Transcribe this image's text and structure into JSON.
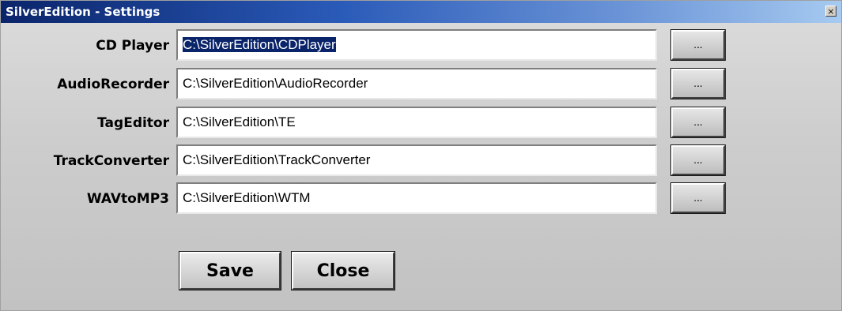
{
  "window": {
    "title": "SilverEdition - Settings",
    "close_glyph": "×",
    "close_icon": "close-icon"
  },
  "colors": {
    "titlebar_start": "#0a246a",
    "titlebar_end": "#a6caf0",
    "selection": "#0a246a",
    "background": "#cdcdcd"
  },
  "settings": {
    "rows": [
      {
        "label": "CD Player",
        "value": "C:\\SilverEdition\\CDPlayer",
        "selected": true,
        "browse_label": "..."
      },
      {
        "label": "AudioRecorder",
        "value": "C:\\SilverEdition\\AudioRecorder",
        "selected": false,
        "browse_label": "..."
      },
      {
        "label": "TagEditor",
        "value": "C:\\SilverEdition\\TE",
        "selected": false,
        "browse_label": "..."
      },
      {
        "label": "TrackConverter",
        "value": "C:\\SilverEdition\\TrackConverter",
        "selected": false,
        "browse_label": "..."
      },
      {
        "label": "WAVtoMP3",
        "value": "C:\\SilverEdition\\WTM",
        "selected": false,
        "browse_label": "..."
      }
    ]
  },
  "actions": {
    "save_label": "Save",
    "close_label": "Close"
  }
}
